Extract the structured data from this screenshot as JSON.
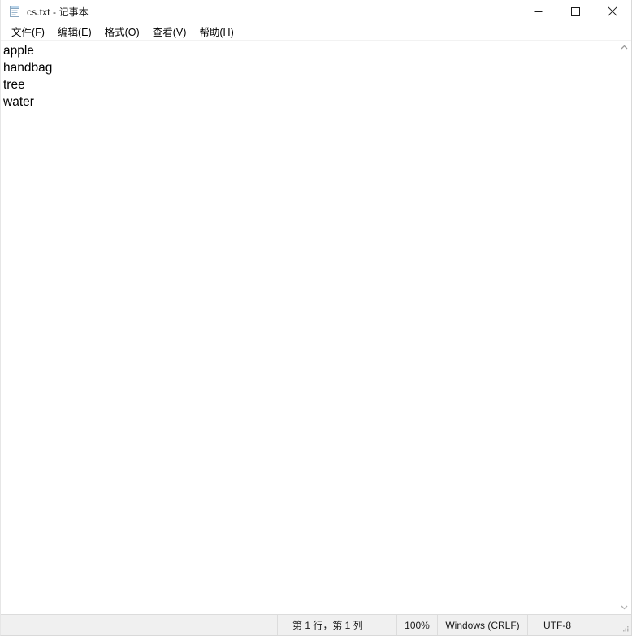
{
  "window": {
    "title": "cs.txt - 记事本",
    "app_icon": "notepad-icon",
    "controls": {
      "minimize_label": "最小化",
      "maximize_label": "最大化",
      "close_label": "关闭"
    }
  },
  "menubar": {
    "items": [
      {
        "label": "文件(F)",
        "name": "menu-file"
      },
      {
        "label": "编辑(E)",
        "name": "menu-edit"
      },
      {
        "label": "格式(O)",
        "name": "menu-format"
      },
      {
        "label": "查看(V)",
        "name": "menu-view"
      },
      {
        "label": "帮助(H)",
        "name": "menu-help"
      }
    ]
  },
  "document": {
    "lines": [
      "apple",
      "handbag",
      "tree",
      "water"
    ],
    "caret_line": 1,
    "caret_column": 1
  },
  "scrollbar": {
    "up_arrow_icon": "chevron-up-icon",
    "down_arrow_icon": "chevron-down-icon"
  },
  "statusbar": {
    "position": "第 1 行，第 1 列",
    "zoom": "100%",
    "line_ending": "Windows (CRLF)",
    "encoding": "UTF-8",
    "grip_icon": "resize-grip-icon"
  },
  "colors": {
    "window_bg": "#ffffff",
    "statusbar_bg": "#f0f0f0",
    "border": "#dcdcdc",
    "text": "#000000",
    "close_hover": "#e81123"
  }
}
